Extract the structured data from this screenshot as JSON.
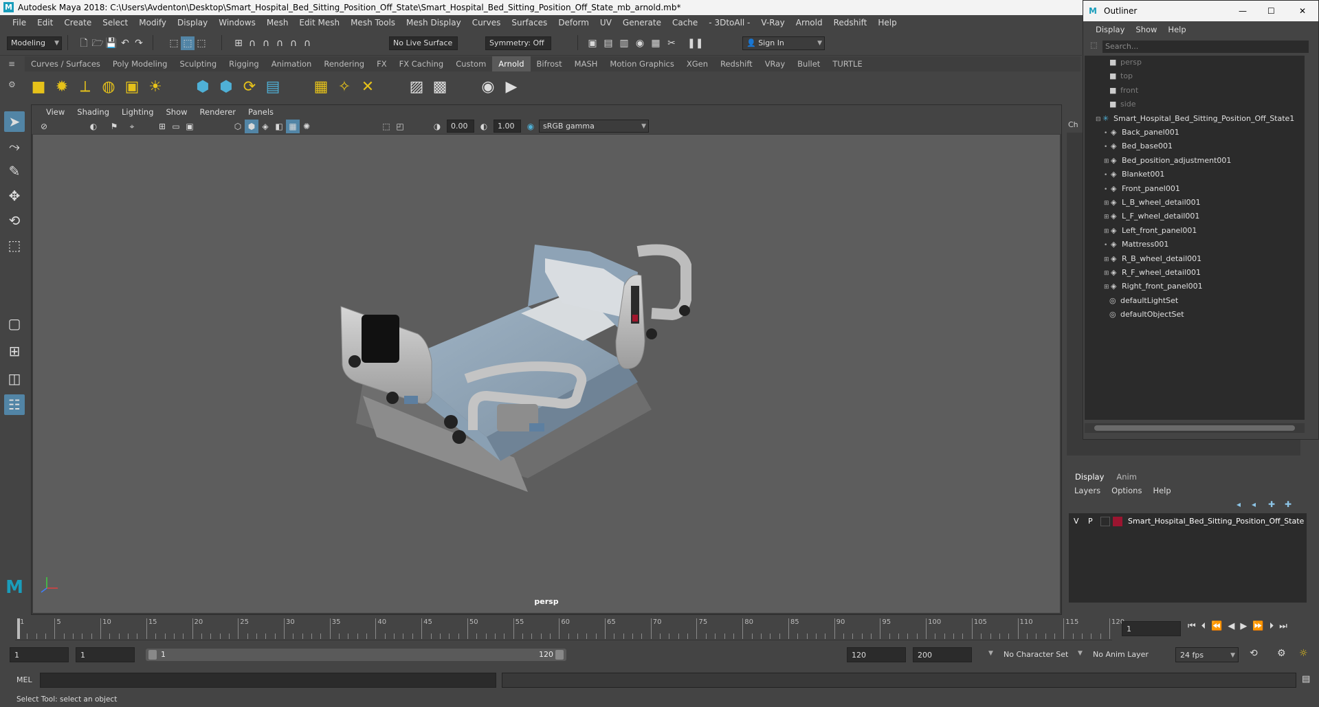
{
  "window": {
    "title": "Autodesk Maya 2018: C:\\Users\\Avdenton\\Desktop\\Smart_Hospital_Bed_Sitting_Position_Off_State\\Smart_Hospital_Bed_Sitting_Position_Off_State_mb_arnold.mb*"
  },
  "menu": [
    "File",
    "Edit",
    "Create",
    "Select",
    "Modify",
    "Display",
    "Windows",
    "Mesh",
    "Edit Mesh",
    "Mesh Tools",
    "Mesh Display",
    "Curves",
    "Surfaces",
    "Deform",
    "UV",
    "Generate",
    "Cache",
    "- 3DtoAll -",
    "V-Ray",
    "Arnold",
    "Redshift",
    "Help"
  ],
  "status_line": {
    "mode": "Modeling",
    "live_surface": "No Live Surface",
    "symmetry": "Symmetry: Off",
    "sign_in": "Sign In"
  },
  "shelf_tabs": [
    "Curves / Surfaces",
    "Poly Modeling",
    "Sculpting",
    "Rigging",
    "Animation",
    "Rendering",
    "FX",
    "FX Caching",
    "Custom",
    "Arnold",
    "Bifrost",
    "MASH",
    "Motion Graphics",
    "XGen",
    "Redshift",
    "VRay",
    "Bullet",
    "TURTLE"
  ],
  "active_shelf": "Arnold",
  "viewport": {
    "menus": [
      "View",
      "Shading",
      "Lighting",
      "Show",
      "Renderer",
      "Panels"
    ],
    "exposure": "0.00",
    "gamma": "1.00",
    "color_space": "sRGB gamma",
    "camera": "persp"
  },
  "outliner": {
    "title": "Outliner",
    "menus": [
      "Display",
      "Show",
      "Help"
    ],
    "search_placeholder": "Search...",
    "cameras": [
      "persp",
      "top",
      "front",
      "side"
    ],
    "root": "Smart_Hospital_Bed_Sitting_Position_Off_State1",
    "children": [
      {
        "name": "Back_panel001",
        "expandable": false
      },
      {
        "name": "Bed_base001",
        "expandable": false
      },
      {
        "name": "Bed_position_adjustment001",
        "expandable": true
      },
      {
        "name": "Blanket001",
        "expandable": false
      },
      {
        "name": "Front_panel001",
        "expandable": false
      },
      {
        "name": "L_B_wheel_detail001",
        "expandable": true
      },
      {
        "name": "L_F_wheel_detail001",
        "expandable": true
      },
      {
        "name": "Left_front_panel001",
        "expandable": true
      },
      {
        "name": "Mattress001",
        "expandable": false
      },
      {
        "name": "R_B_wheel_detail001",
        "expandable": true
      },
      {
        "name": "R_F_wheel_detail001",
        "expandable": true
      },
      {
        "name": "Right_front_panel001",
        "expandable": true
      }
    ],
    "sets": [
      "defaultLightSet",
      "defaultObjectSet"
    ]
  },
  "channel_box_tab": "Ch",
  "layer_editor": {
    "tabs": [
      "Display",
      "Anim"
    ],
    "menus": [
      "Layers",
      "Options",
      "Help"
    ],
    "layer": {
      "v": "V",
      "p": "P",
      "name": "Smart_Hospital_Bed_Sitting_Position_Off_State",
      "color": "#9b1530"
    }
  },
  "time_slider": {
    "ticks": [
      1,
      5,
      10,
      15,
      20,
      25,
      30,
      35,
      40,
      45,
      50,
      55,
      60,
      65,
      70,
      75,
      80,
      85,
      90,
      95,
      100,
      105,
      110,
      115,
      120
    ],
    "current_frame": "1"
  },
  "range": {
    "start": "1",
    "anim_start": "1",
    "slider_start": "1",
    "slider_end": "120",
    "end": "120",
    "anim_end": "200",
    "character_set": "No Character Set",
    "anim_layer": "No Anim Layer",
    "fps": "24 fps"
  },
  "command_line": {
    "label": "MEL"
  },
  "help_line": "Select Tool: select an object"
}
